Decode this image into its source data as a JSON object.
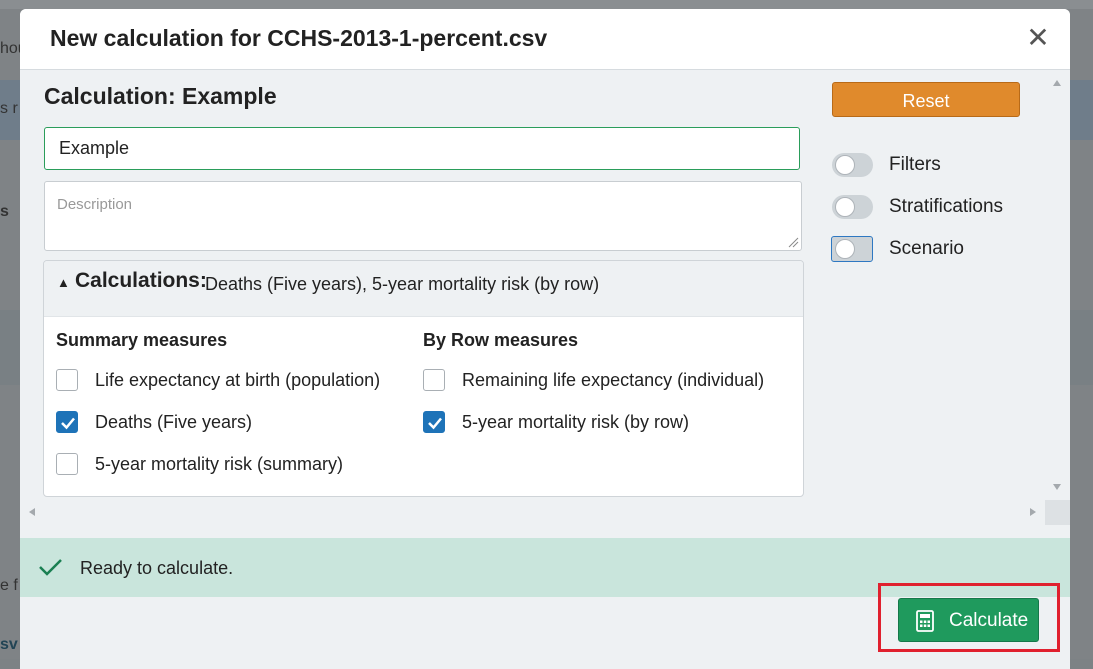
{
  "background": {
    "fragments": [
      "hou",
      "s r",
      "s",
      "e f",
      "sv"
    ]
  },
  "modal": {
    "title": "New calculation for CCHS-2013-1-percent.csv",
    "close_label": "✕"
  },
  "form": {
    "heading": "Calculation: Example",
    "name_value": "Example",
    "description_placeholder": "Description"
  },
  "calculations": {
    "title": "Calculations:",
    "summary": "Deaths (Five years), 5-year mortality risk (by row)",
    "summary_col": {
      "header": "Summary measures",
      "items": [
        {
          "label": "Life expectancy at birth (population)",
          "checked": false
        },
        {
          "label": "Deaths (Five years)",
          "checked": true
        },
        {
          "label": "5-year mortality risk (summary)",
          "checked": false
        }
      ]
    },
    "row_col": {
      "header": "By Row measures",
      "items": [
        {
          "label": "Remaining life expectancy (individual)",
          "checked": false
        },
        {
          "label": "5-year mortality risk (by row)",
          "checked": true
        }
      ]
    }
  },
  "options": {
    "reset_label": "Reset",
    "toggles": [
      {
        "label": "Filters",
        "on": false
      },
      {
        "label": "Stratifications",
        "on": false
      },
      {
        "label": "Scenario",
        "on": false,
        "focused": true
      }
    ]
  },
  "status": {
    "text": "Ready to calculate."
  },
  "footer": {
    "calculate_label": "Calculate"
  },
  "colors": {
    "accent_green": "#1f9a5d",
    "reset_orange": "#e08a2c",
    "checkbox_blue": "#1e73b8",
    "status_bg": "#c9e5dc",
    "highlight_red": "#e0202e"
  }
}
